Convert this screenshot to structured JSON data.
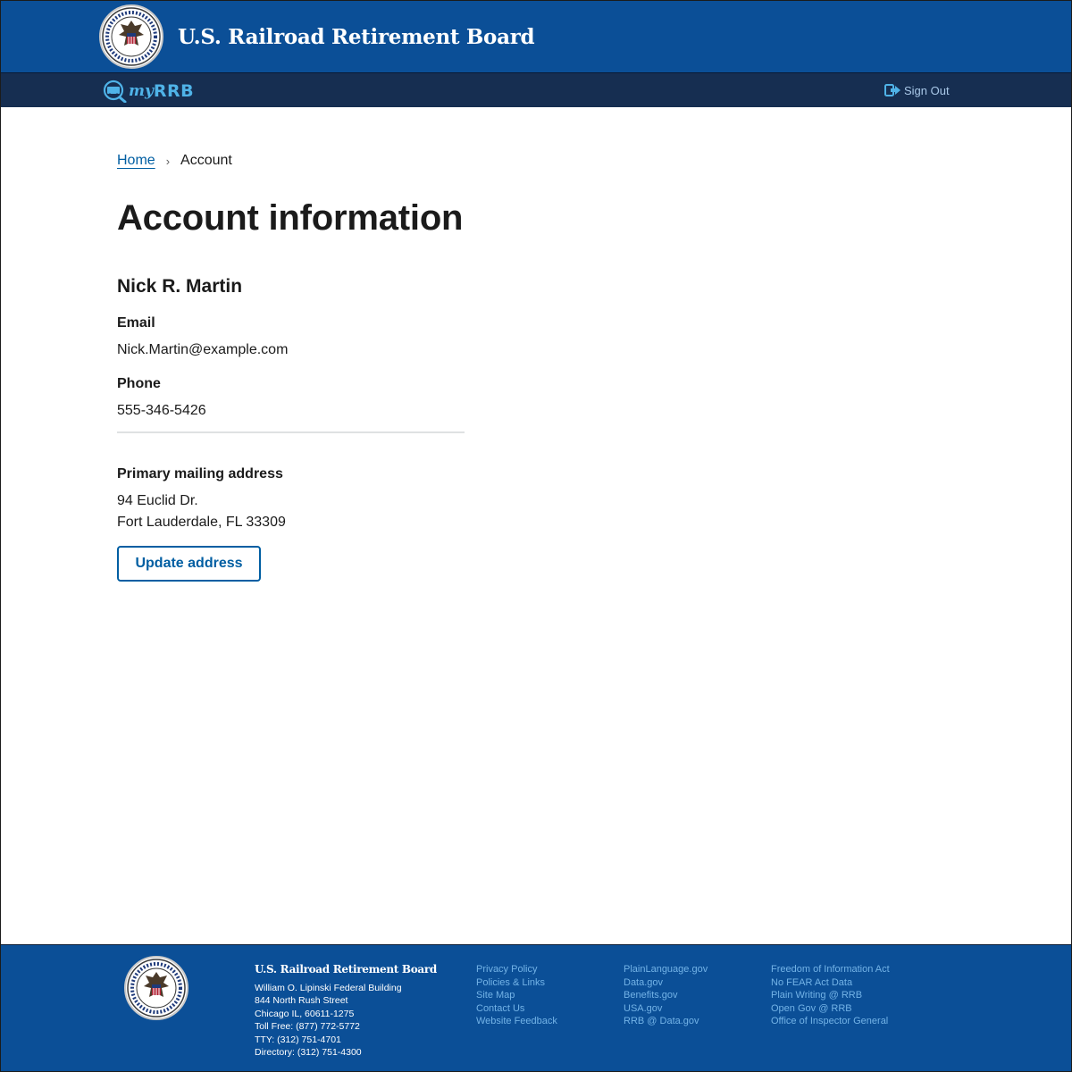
{
  "header": {
    "site_title": "U.S. Railroad Retirement Board",
    "seal_text": "RAILROAD RETIREMENT BOARD · U.S.A."
  },
  "nav": {
    "logo_my": "my",
    "logo_rrb": "RRB",
    "sign_out_label": "Sign Out"
  },
  "breadcrumb": {
    "home": "Home",
    "separator": "›",
    "current": "Account"
  },
  "page": {
    "title": "Account information",
    "user_name": "Nick R. Martin",
    "email_label": "Email",
    "email_value": "Nick.Martin@example.com",
    "phone_label": "Phone",
    "phone_value": "555-346-5426",
    "address_label": "Primary mailing address",
    "address_line1": "94 Euclid Dr.",
    "address_line2": "Fort Lauderdale, FL 33309",
    "update_button": "Update address"
  },
  "footer": {
    "org_name": "U.S. Railroad Retirement Board",
    "address_lines": [
      "William O. Lipinski Federal Building",
      "844 North Rush Street",
      "Chicago IL, 60611-1275",
      "Toll Free: (877) 772-5772",
      "TTY: (312) 751-4701",
      "Directory: (312) 751-4300"
    ],
    "links_col1": [
      "Privacy Policy",
      "Policies & Links",
      "Site Map",
      "Contact Us",
      "Website Feedback"
    ],
    "links_col2": [
      "PlainLanguage.gov",
      "Data.gov",
      "Benefits.gov",
      "USA.gov",
      "RRB @ Data.gov"
    ],
    "links_col3": [
      "Freedom of Information Act",
      "No FEAR Act Data",
      "Plain Writing @ RRB",
      "Open Gov @ RRB",
      "Office of Inspector General"
    ]
  },
  "colors": {
    "header_blue": "#0b4f97",
    "nav_navy": "#162e51",
    "link_blue": "#005ea2",
    "footer_link": "#73b3e7",
    "myrrb_cyan": "#4fb3e8"
  },
  "icons": {
    "seal": "rrb-seal-icon",
    "myrrb": "myrrb-logo-icon",
    "sign_out": "sign-out-icon"
  }
}
